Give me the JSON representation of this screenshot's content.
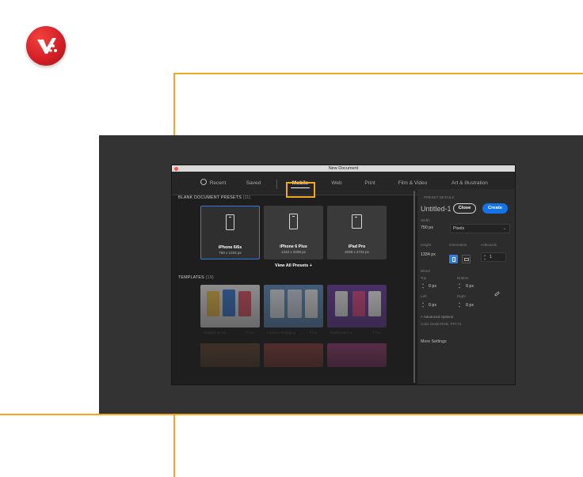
{
  "dialog": {
    "title": "New Document",
    "tabs": [
      {
        "label": "Recent"
      },
      {
        "label": "Saved"
      },
      {
        "label": "Mobile"
      },
      {
        "label": "Web"
      },
      {
        "label": "Print"
      },
      {
        "label": "Film & Video"
      },
      {
        "label": "Art & Illustration"
      }
    ],
    "active_tab": "Mobile",
    "highlight_color": "#f5a623"
  },
  "presets": {
    "heading": "BLANK DOCUMENT PRESETS",
    "count": "(11)",
    "items": [
      {
        "name": "iPhone 6/6s",
        "size": "750 x 1334 px",
        "selected": true
      },
      {
        "name": "iPhone 6 Plus",
        "size": "1242 x 2208 px",
        "selected": false
      },
      {
        "name": "iPad Pro",
        "size": "2048 x 2732 px",
        "selected": false
      }
    ],
    "view_all": "View All Presets +"
  },
  "templates": {
    "heading": "TEMPLATES",
    "count": "(19)",
    "captions": [
      "Multiple UI Kit",
      "Free",
      "Fashion Shopping",
      "Free",
      "Dashboard UI",
      "Free"
    ]
  },
  "details": {
    "heading": "PRESET DETAILS",
    "doc_name": "Untitled-1",
    "width_label": "Width",
    "width_value": "750 px",
    "unit": "Pixels",
    "height_label": "Height",
    "height_value": "1334 px",
    "orientation_label": "Orientation",
    "artboards_label": "Artboards",
    "artboards_value": "1",
    "bleed_label": "Bleed",
    "top_label": "Top",
    "top_value": "0 px",
    "bottom_label": "Bottom",
    "bottom_value": "0 px",
    "left_label": "Left",
    "left_value": "0 px",
    "right_label": "Right",
    "right_value": "0 px",
    "advanced": "> Advanced Options",
    "color_mode": "Color Mode:RGB, PPI:72",
    "more_settings": "More Settings"
  },
  "buttons": {
    "close": "Close",
    "create": "Create"
  },
  "colors": {
    "accent_blue": "#1473e6",
    "frame_orange": "#f5a623",
    "brand_red": "#d61f26"
  }
}
